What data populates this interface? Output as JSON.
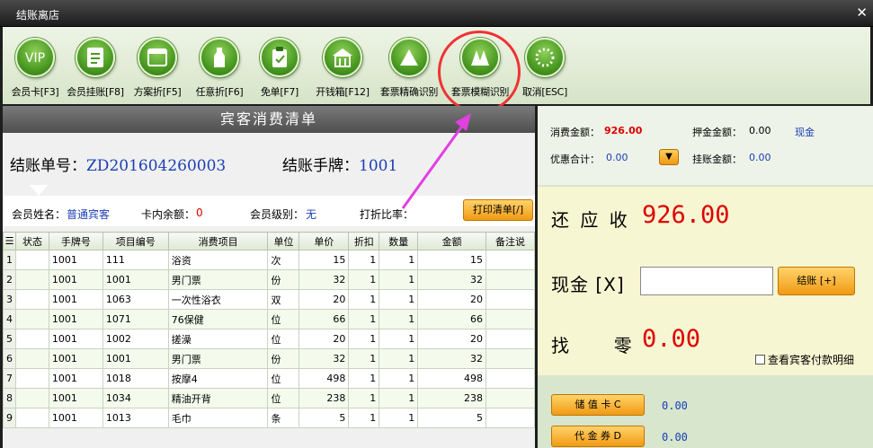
{
  "window": {
    "title": "结账离店",
    "close_icon": "✕"
  },
  "toolbar": [
    {
      "name": "member-card",
      "label": "会员卡[F3]",
      "icon": "vip-icon"
    },
    {
      "name": "member-charge",
      "label": "会员挂账[F8]",
      "icon": "document-icon"
    },
    {
      "name": "plan-discount",
      "label": "方案折[F5]",
      "icon": "window-icon"
    },
    {
      "name": "any-discount",
      "label": "任意折[F6]",
      "icon": "bottle-icon"
    },
    {
      "name": "free-order",
      "label": "免单[F7]",
      "icon": "clipboard-icon"
    },
    {
      "name": "cash-box",
      "label": "开钱箱[F12]",
      "icon": "house-icon"
    },
    {
      "name": "ticket-exact",
      "label": "套票精确识别",
      "icon": "triangle-icon"
    },
    {
      "name": "ticket-fuzzy",
      "label": "套票模糊识别",
      "icon": "double-triangle-icon"
    },
    {
      "name": "cancel",
      "label": "取消[ESC]",
      "icon": "dotted-circle-icon"
    }
  ],
  "bill": {
    "header": "宾客消费清单",
    "order_label": "结账单号：",
    "order_no": "ZD201604260003",
    "tag_label": "结账手牌：",
    "tag_no": "1001",
    "member_name_label": "会员姓名：",
    "member_name": "普通宾客",
    "card_balance_label": "卡内余额：",
    "card_balance": "0",
    "member_level_label": "会员级别：",
    "member_level": "无",
    "discount_label": "打折比率：",
    "discount": "",
    "print_label": "打印清单[/]"
  },
  "table": {
    "columns": [
      "☰",
      "状态",
      "手牌号",
      "项目编号",
      "消费项目",
      "单位",
      "单价",
      "折扣",
      "数量",
      "金额",
      "备注说"
    ],
    "rows": [
      [
        "1",
        "",
        "1001",
        "111",
        "浴资",
        "次",
        "15",
        "1",
        "1",
        "15",
        ""
      ],
      [
        "2",
        "",
        "1001",
        "1001",
        "男门票",
        "份",
        "32",
        "1",
        "1",
        "32",
        ""
      ],
      [
        "3",
        "",
        "1001",
        "1063",
        "一次性浴衣",
        "双",
        "20",
        "1",
        "1",
        "20",
        ""
      ],
      [
        "4",
        "",
        "1001",
        "1071",
        "76保健",
        "位",
        "66",
        "1",
        "1",
        "66",
        ""
      ],
      [
        "5",
        "",
        "1001",
        "1002",
        "搓澡",
        "位",
        "20",
        "1",
        "1",
        "20",
        ""
      ],
      [
        "6",
        "",
        "1001",
        "1001",
        "男门票",
        "份",
        "32",
        "1",
        "1",
        "32",
        ""
      ],
      [
        "7",
        "",
        "1001",
        "1018",
        "按摩4",
        "位",
        "498",
        "1",
        "1",
        "498",
        ""
      ],
      [
        "8",
        "",
        "1001",
        "1034",
        "精油开背",
        "位",
        "238",
        "1",
        "1",
        "238",
        ""
      ],
      [
        "9",
        "",
        "1001",
        "1013",
        "毛巾",
        "条",
        "5",
        "1",
        "1",
        "5",
        ""
      ]
    ]
  },
  "summary": {
    "consume_label": "消费金额：",
    "consume": "926.00",
    "deposit_label": "押金金额：",
    "deposit": "0.00",
    "cash_word": "现金",
    "discount_total_label": "优惠合计：",
    "discount_total": "0.00",
    "charge_label": "挂账金额：",
    "charge": "0.00"
  },
  "payment": {
    "receivable_label": "还 应 收",
    "receivable": "926.00",
    "cash_label": "现金 [X]",
    "cash_value": "",
    "settle_label": "结账 [+]",
    "change_label": "找     零",
    "change": "0.00",
    "view_detail_label": "查看宾客付款明细",
    "stored_card_label": "储 值 卡 C",
    "stored_card": "0.00",
    "voucher_label": "代 金 券 D",
    "voucher": "0.00"
  },
  "colors": {
    "accent_red": "#e00000",
    "value_blue": "#1a3fb5",
    "button_orange": "#f09a14",
    "highlight": "#e33333",
    "arrow": "#e040e0"
  }
}
